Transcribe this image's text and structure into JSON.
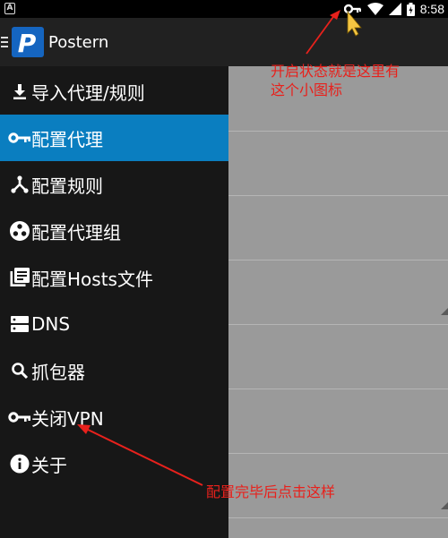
{
  "status_bar": {
    "time": "8:58",
    "left_indicator": "A",
    "icons": [
      "vpn-key-icon",
      "wifi-icon",
      "signal-icon",
      "battery-icon"
    ]
  },
  "app_bar": {
    "title": "Postern",
    "logo_letter": "P"
  },
  "drawer": {
    "items": [
      {
        "label": "导入代理/规则",
        "icon": "download-icon",
        "active": false
      },
      {
        "label": "配置代理",
        "icon": "key-icon",
        "active": true
      },
      {
        "label": "配置规则",
        "icon": "fork-icon",
        "active": false
      },
      {
        "label": "配置代理组",
        "icon": "group-icon",
        "active": false
      },
      {
        "label": "配置Hosts文件",
        "icon": "library-icon",
        "active": false
      },
      {
        "label": "DNS",
        "icon": "server-icon",
        "active": false
      },
      {
        "label": "抓包器",
        "icon": "search-icon",
        "active": false
      },
      {
        "label": "关闭VPN",
        "icon": "key-icon",
        "active": false
      },
      {
        "label": "关于",
        "icon": "info-icon",
        "active": false
      }
    ]
  },
  "annotations": {
    "top_line1": "开启状态就是这里有",
    "top_line2": "这个小图标",
    "bottom": "配置完毕后点击这样"
  },
  "colors": {
    "active_item": "#0a7ec0",
    "annotation": "#e8211c",
    "content_bg": "#9a9a9a"
  }
}
